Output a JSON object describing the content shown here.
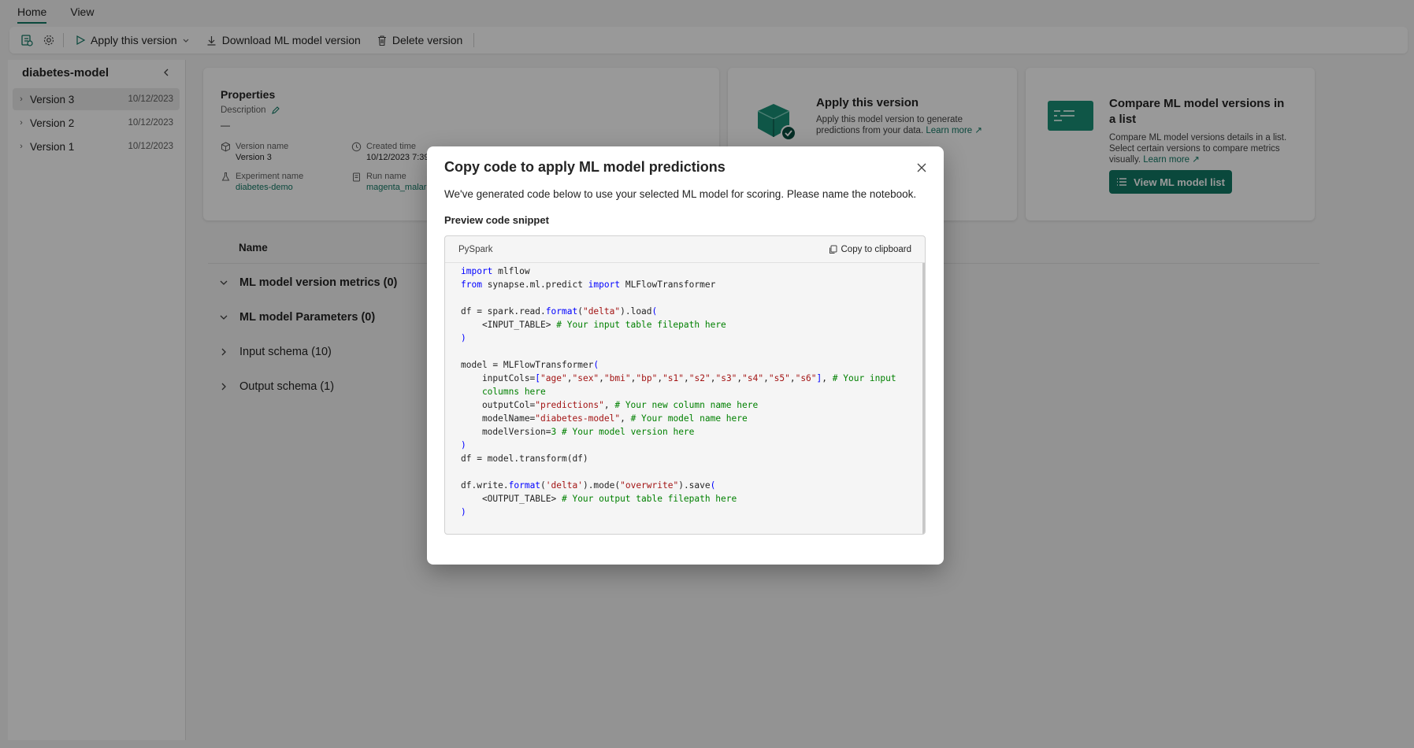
{
  "tabs": [
    {
      "label": "Home",
      "active": true
    },
    {
      "label": "View",
      "active": false
    }
  ],
  "ribbon": {
    "icons": [
      "new-version-icon",
      "settings-icon"
    ],
    "apply_label": "Apply this version",
    "download_label": "Download ML model version",
    "delete_label": "Delete version"
  },
  "sidebar": {
    "title": "diabetes-model",
    "versions": [
      {
        "name": "Version 3",
        "date": "10/12/2023",
        "selected": true
      },
      {
        "name": "Version 2",
        "date": "10/12/2023",
        "selected": false
      },
      {
        "name": "Version 1",
        "date": "10/12/2023",
        "selected": false
      }
    ]
  },
  "properties": {
    "title": "Properties",
    "description_label": "Description",
    "description_value": "—",
    "version_name_label": "Version name",
    "version_name": "Version 3",
    "created_label": "Created time",
    "created_value": "10/12/2023 7:39",
    "experiment_label": "Experiment name",
    "experiment_value": "diabetes-demo",
    "run_label": "Run name",
    "run_value": "magenta_malar"
  },
  "apply_card": {
    "title": "Apply this version",
    "text": "Apply this model version to generate predictions from your data.",
    "learn_more": "Learn more"
  },
  "compare_card": {
    "title": "Compare ML model versions in a list",
    "text": "Compare ML model versions details in a list. Select certain versions to compare metrics visually.",
    "learn_more": "Learn more",
    "button": "View ML model list"
  },
  "list": {
    "header": "Name",
    "sections": [
      {
        "label": "ML model version metrics (0)",
        "expanded": true,
        "bold": true
      },
      {
        "label": "ML model Parameters (0)",
        "expanded": true,
        "bold": true
      },
      {
        "label": "Input schema (10)",
        "expanded": false,
        "bold": false
      },
      {
        "label": "Output schema (1)",
        "expanded": false,
        "bold": false
      }
    ]
  },
  "dialog": {
    "title": "Copy code to apply ML model predictions",
    "description": "We've generated code below to use your selected ML model for scoring. Please name the notebook.",
    "preview_label": "Preview code snippet",
    "language": "PySpark",
    "copy_label": "Copy to clipboard"
  },
  "colors": {
    "accent": "#117865",
    "keyword": "#0000ff",
    "string": "#a31515",
    "comment": "#008000"
  }
}
